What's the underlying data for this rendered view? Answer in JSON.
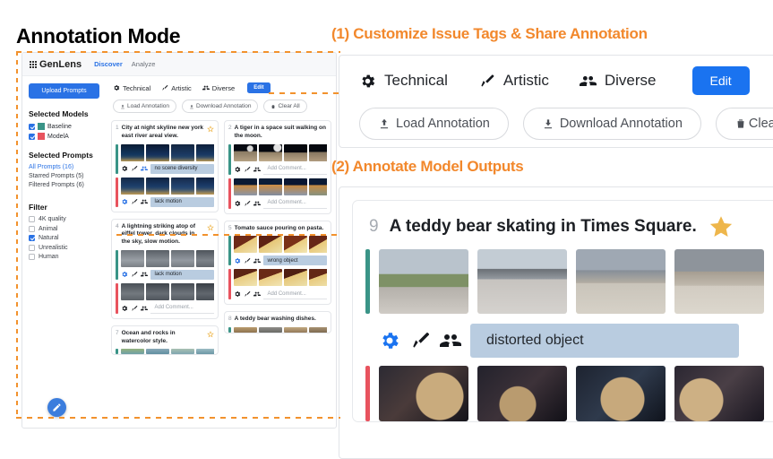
{
  "page_title": "Annotation Mode",
  "app": {
    "brand": "GenLens",
    "nav": [
      {
        "label": "Discover",
        "active": true
      },
      {
        "label": "Analyze",
        "active": false
      }
    ],
    "sidebar": {
      "upload_button": "Upload Prompts",
      "selected_models_heading": "Selected Models",
      "models": [
        {
          "name": "Baseline",
          "color": "#3a9487",
          "checked": true
        },
        {
          "name": "ModelA",
          "color": "#e8535e",
          "checked": true
        }
      ],
      "selected_prompts_heading": "Selected Prompts",
      "prompt_links": [
        {
          "label": "All Prompts (16)",
          "active": true
        },
        {
          "label": "Starred Prompts (5)",
          "active": false
        },
        {
          "label": "Filtered Prompts (6)",
          "active": false
        }
      ],
      "filter_heading": "Filter",
      "filters": [
        {
          "label": "4K quality",
          "checked": false
        },
        {
          "label": "Animal",
          "checked": false
        },
        {
          "label": "Natural",
          "checked": true
        },
        {
          "label": "Unrealistic",
          "checked": false
        },
        {
          "label": "Human",
          "checked": false
        }
      ]
    },
    "tags": [
      {
        "label": "Technical",
        "icon": "gear-icon"
      },
      {
        "label": "Artistic",
        "icon": "brush-icon"
      },
      {
        "label": "Diverse",
        "icon": "people-icon"
      }
    ],
    "edit_button": "Edit",
    "action_pills": [
      {
        "label": "Load Annotation",
        "icon": "upload-icon"
      },
      {
        "label": "Download Annotation",
        "icon": "download-icon"
      },
      {
        "label": "Clear All",
        "icon": "trash-icon"
      }
    ],
    "fab": "edit-pencil",
    "cards": [
      {
        "index": "1",
        "prompt": "City at night skyline new york east river areal view.",
        "starred": true,
        "rows": [
          {
            "model": "Baseline",
            "color": "#3a9487",
            "comment": "no scene diversity",
            "comment_filled": true,
            "gear_active": false
          },
          {
            "model": "ModelA",
            "color": "#e8535e",
            "comment": "lack motion",
            "comment_filled": true,
            "gear_active": true
          }
        ]
      },
      {
        "index": "2",
        "prompt": "A tiger in a space suit walking on the moon.",
        "starred": false,
        "rows": [
          {
            "model": "Baseline",
            "color": "#3a9487",
            "comment": "Add Comment...",
            "comment_filled": false,
            "gear_active": false
          },
          {
            "model": "ModelA",
            "color": "#e8535e",
            "comment": "Add Comment...",
            "comment_filled": false,
            "gear_active": false
          }
        ]
      },
      {
        "index": "4",
        "prompt": "A lightning striking atop of eiffel tower, dark clouds in the sky, slow motion.",
        "starred": true,
        "rows": [
          {
            "model": "Baseline",
            "color": "#3a9487",
            "comment": "lack motion",
            "comment_filled": true,
            "gear_active": true
          },
          {
            "model": "ModelA",
            "color": "#e8535e",
            "comment": "Add Comment...",
            "comment_filled": false,
            "gear_active": false
          }
        ]
      },
      {
        "index": "5",
        "prompt": "Tomato sauce pouring on pasta.",
        "starred": false,
        "rows": [
          {
            "model": "Baseline",
            "color": "#3a9487",
            "comment": "wrong object",
            "comment_filled": true,
            "gear_active": true
          },
          {
            "model": "ModelA",
            "color": "#e8535e",
            "comment": "Add Comment...",
            "comment_filled": false,
            "gear_active": false
          }
        ]
      },
      {
        "index": "7",
        "prompt": "Ocean and rocks in watercolor style.",
        "starred": true,
        "rows": []
      },
      {
        "index": "8",
        "prompt": "A teddy bear washing dishes.",
        "starred": false,
        "rows": []
      }
    ]
  },
  "callouts": {
    "one": {
      "title": "(1) Customize Issue Tags & Share Annotation",
      "tags": [
        {
          "label": "Technical",
          "icon": "gear-icon"
        },
        {
          "label": "Artistic",
          "icon": "brush-icon"
        },
        {
          "label": "Diverse",
          "icon": "people-icon"
        }
      ],
      "edit_button": "Edit",
      "pills": [
        {
          "label": "Load Annotation",
          "icon": "upload-icon"
        },
        {
          "label": "Download Annotation",
          "icon": "download-icon"
        },
        {
          "label": "Clear All",
          "icon": "trash-icon"
        }
      ]
    },
    "two": {
      "title": "(2) Annotate Model Outputs",
      "card": {
        "index": "9",
        "prompt": "A teddy bear skating in Times Square.",
        "starred": true,
        "rows": [
          {
            "model": "Baseline",
            "color": "#3a9487",
            "comment": "distorted object",
            "gear_active": true
          },
          {
            "model": "ModelA",
            "color": "#e8535e",
            "comment": "",
            "gear_active": false
          }
        ]
      }
    }
  },
  "colors": {
    "accent_orange": "#f2882c",
    "brand_blue": "#2a72e5",
    "baseline_teal": "#3a9487",
    "modela_red": "#e8535e",
    "comment_bg": "#b9cce0",
    "star_gold": "#eeb64b"
  }
}
